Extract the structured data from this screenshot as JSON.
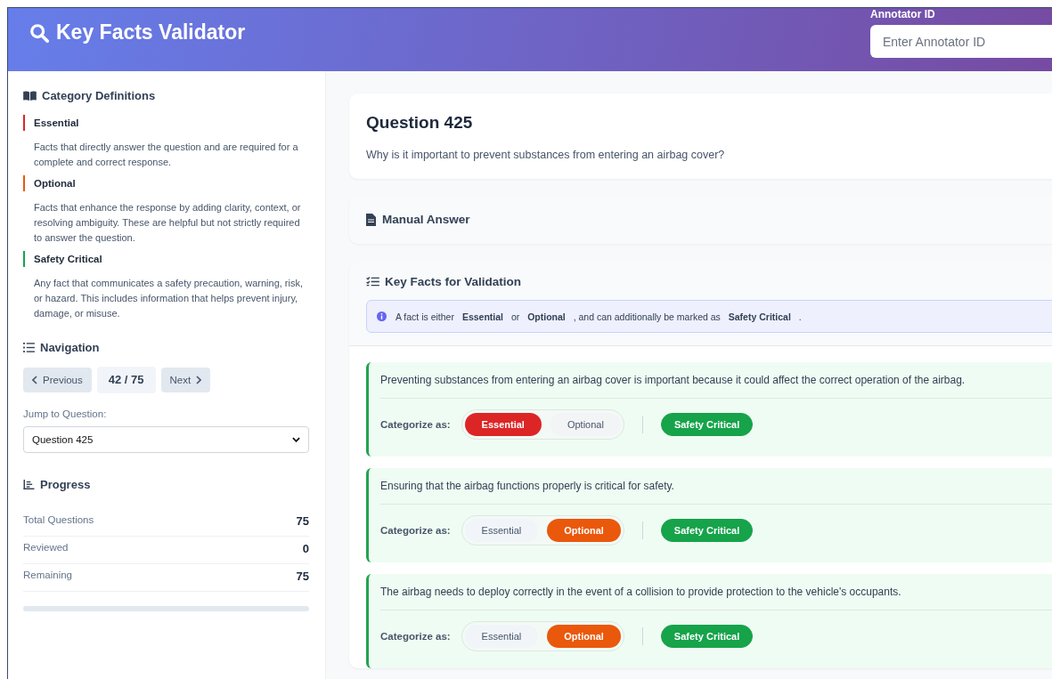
{
  "header": {
    "title": "Key Facts Validator",
    "annotator": {
      "label": "Annotator ID",
      "placeholder": "Enter Annotator ID"
    }
  },
  "sidebar": {
    "definitions": {
      "title": "Category Definitions",
      "items": [
        {
          "name": "Essential",
          "color": "#dc2626",
          "text": "Facts that directly answer the question and are required for a complete and correct response."
        },
        {
          "name": "Optional",
          "color": "#ea580c",
          "text": "Facts that enhance the response by adding clarity, context, or resolving ambiguity. These are helpful but not strictly required to answer the question."
        },
        {
          "name": "Safety Critical",
          "color": "#16a34a",
          "text": "Any fact that communicates a safety precaution, warning, risk, or hazard. This includes information that helps prevent injury, damage, or misuse."
        }
      ]
    },
    "navigation": {
      "title": "Navigation",
      "previous": "Previous",
      "counter": "42 / 75",
      "next": "Next",
      "jump_label": "Jump to Question:",
      "jump_value": "Question 425"
    },
    "progress": {
      "title": "Progress",
      "stats": [
        {
          "label": "Total Questions",
          "value": "75"
        },
        {
          "label": "Reviewed",
          "value": "0"
        },
        {
          "label": "Remaining",
          "value": "75"
        }
      ],
      "level": 0
    }
  },
  "question": {
    "title": "Question 425",
    "text": "Why is it important to prevent substances from entering an airbag cover?"
  },
  "manual_answer": {
    "title": "Manual Answer"
  },
  "key_facts": {
    "title": "Key Facts for Validation",
    "info": "A fact is either **Essential** or **Optional** , and can additionally be marked as **Safety Critical** .",
    "facts": [
      {
        "text": "Preventing substances from entering an airbag cover is important because it could affect the correct operation of the airbag.",
        "label": "Categorize as:",
        "options": [
          {
            "label": "Essential",
            "kind": "essential",
            "selected": true
          },
          {
            "label": "Optional",
            "kind": "optional",
            "selected": false
          }
        ],
        "safety": {
          "label": "Safety Critical",
          "on": true
        }
      },
      {
        "text": "Ensuring that the airbag functions properly is critical for safety.",
        "label": "Categorize as:",
        "options": [
          {
            "label": "Essential",
            "kind": "essential",
            "selected": false
          },
          {
            "label": "Optional",
            "kind": "optional",
            "selected": true
          }
        ],
        "safety": {
          "label": "Safety Critical",
          "on": true
        }
      },
      {
        "text": "The airbag needs to deploy correctly in the event of a collision to provide protection to the vehicle's occupants.",
        "label": "Categorize as:",
        "options": [
          {
            "label": "Essential",
            "kind": "essential",
            "selected": false
          },
          {
            "label": "Optional",
            "kind": "optional",
            "selected": true
          }
        ],
        "safety": {
          "label": "Safety Critical",
          "on": true
        }
      }
    ]
  }
}
